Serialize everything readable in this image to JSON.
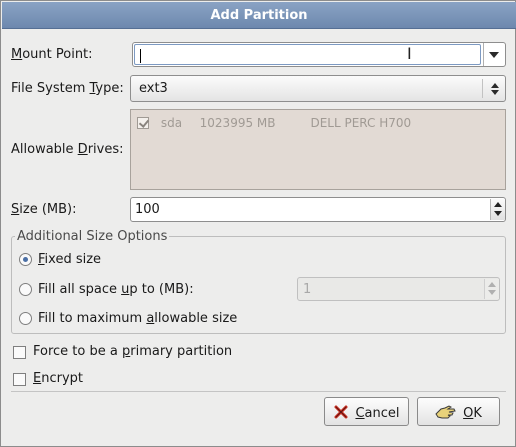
{
  "dialog": {
    "title": "Add Partition"
  },
  "mount_point": {
    "label_pre": "",
    "label_u": "M",
    "label_post": "ount Point:",
    "value": ""
  },
  "fs_type": {
    "label_pre": "File System ",
    "label_u": "T",
    "label_post": "ype:",
    "value": "ext3"
  },
  "drives": {
    "label_pre": "Allowable ",
    "label_u": "D",
    "label_post": "rives:",
    "rows": [
      {
        "checked": true,
        "name": "sda",
        "size": "1023995 MB",
        "model": "DELL PERC H700"
      }
    ]
  },
  "size": {
    "label_pre": "",
    "label_u": "S",
    "label_post": "ize (MB):",
    "value": "100"
  },
  "options": {
    "legend": "Additional Size Options",
    "fixed": {
      "pre": "",
      "u": "F",
      "post": "ixed size",
      "selected": true
    },
    "fill_up": {
      "pre": "Fill all space ",
      "u": "u",
      "post": "p to (MB):",
      "selected": false,
      "value": "1"
    },
    "fill_max": {
      "pre": "Fill to maximum ",
      "u": "a",
      "post": "llowable size",
      "selected": false
    }
  },
  "primary": {
    "pre": "Force to be a ",
    "u": "p",
    "post": "rimary partition",
    "checked": false
  },
  "encrypt": {
    "pre": "",
    "u": "E",
    "post": "ncrypt",
    "checked": false
  },
  "buttons": {
    "cancel": {
      "pre": "",
      "u": "C",
      "post": "ancel",
      "icon": "cancel-x-icon"
    },
    "ok": {
      "pre": "",
      "u": "O",
      "post": "K",
      "icon": "ok-hand-icon"
    }
  },
  "colors": {
    "title_bar": "#7b94b9",
    "accent": "#4a6fa5",
    "cancel_icon": "#c62d1f"
  }
}
